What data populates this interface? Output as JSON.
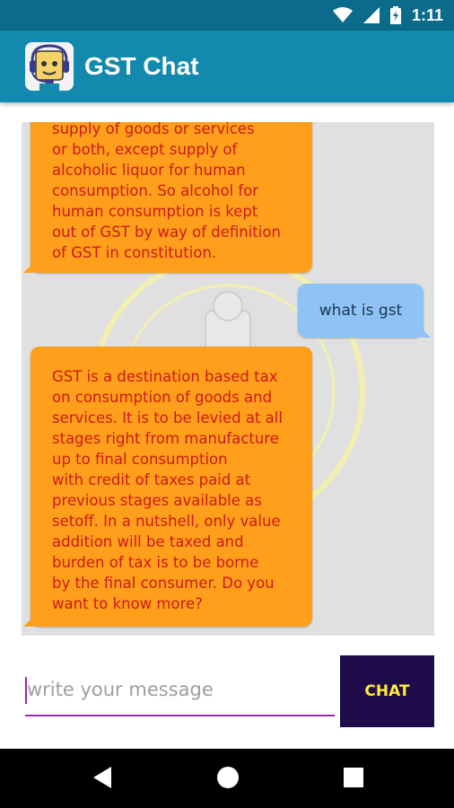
{
  "status_bar": {
    "time": "1:11"
  },
  "app_bar": {
    "title": "GST Chat"
  },
  "chat": {
    "messages": [
      {
        "sender": "bot",
        "lines": [
          "supply of goods or services",
          "or both, except supply of",
          "alcoholic liquor for human",
          "consumption. So alcohol for",
          "human consumption is kept",
          "out of GST by way of definition",
          "of GST in constitution."
        ]
      },
      {
        "sender": "user",
        "text": "what is gst"
      },
      {
        "sender": "bot",
        "lines": [
          "GST is a destination based tax",
          "on consumption of goods and",
          "services. It is to be levied at all",
          "stages right from manufacture",
          "up to final consumption",
          "with credit of taxes paid at",
          "previous stages available as",
          "setoff. In a nutshell, only value",
          "addition will be taxed and",
          "burden of tax is to be borne",
          "by the final consumer. Do you",
          "want to know more?"
        ]
      }
    ]
  },
  "composer": {
    "placeholder": "write your message",
    "value": "",
    "send_label": "CHAT"
  },
  "colors": {
    "status_bar": "#0b6b8a",
    "app_bar": "#1389ad",
    "bot_bubble": "#ff9f1c",
    "bot_text": "#cc1a1a",
    "user_bubble": "#8fc3f5",
    "send_button": "#1f0a4a",
    "send_text": "#ffeb3b",
    "input_underline": "#9c27b0"
  },
  "icons": [
    "wifi-icon",
    "signal-icon",
    "battery-icon",
    "chatbot-logo-icon",
    "back-icon",
    "home-icon",
    "recents-icon"
  ]
}
